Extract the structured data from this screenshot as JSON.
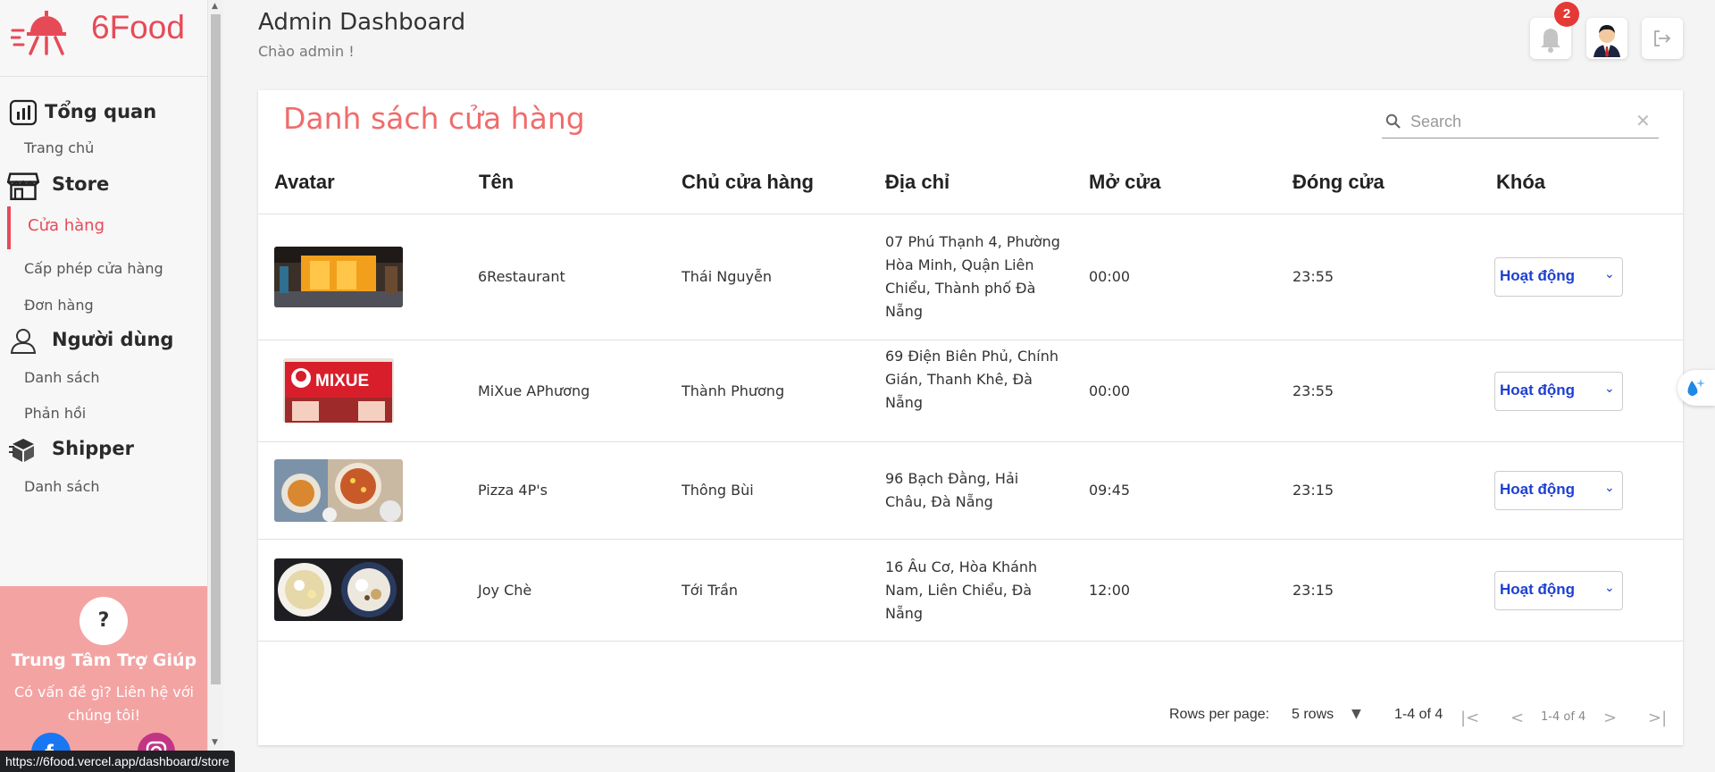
{
  "app": {
    "logo_text": "6Food",
    "status_url": "https://6food.vercel.app/dashboard/store"
  },
  "sidebar": {
    "groups": [
      {
        "title": "Tổng quan",
        "icon": "chart-icon",
        "items": [
          "Trang chủ"
        ]
      },
      {
        "title": "Store",
        "icon": "store-icon",
        "items": [
          "Cửa hàng",
          "Cấp phép cửa hàng",
          "Đơn hàng"
        ]
      },
      {
        "title": "Người dùng",
        "icon": "user-icon",
        "items": [
          "Danh sách",
          "Phản hồi"
        ]
      },
      {
        "title": "Shipper",
        "icon": "box-icon",
        "items": [
          "Danh sách"
        ]
      }
    ],
    "active_item": "Cửa hàng",
    "help": {
      "icon_text": "?",
      "title": "Trung Tâm Trợ Giúp",
      "text": "Có vấn đề gì? Liên hệ với chúng tôi!"
    }
  },
  "header": {
    "title": "Admin Dashboard",
    "subtitle": "Chào admin !",
    "notification_count": "2"
  },
  "main": {
    "title": "Danh sách cửa hàng",
    "search_placeholder": "Search",
    "columns": [
      "Avatar",
      "Tên",
      "Chủ cửa hàng",
      "Địa chỉ",
      "Mở cửa",
      "Đóng cửa",
      "Khóa"
    ],
    "rows": [
      {
        "name": "6Restaurant",
        "owner": "Thái Nguyễn",
        "address": "07 Phú Thạnh 4, Phường Hòa Minh, Quận Liên Chiểu, Thành phố Đà Nẵng",
        "open": "00:00",
        "close": "23:55",
        "status": "Hoạt động",
        "thumb": "restaurant-photo"
      },
      {
        "name": "MiXue APhương",
        "owner": "Thành Phương",
        "address": "69 Điện Biên Phủ, Chính Gián, Thanh Khê, Đà Nẵng",
        "open": "00:00",
        "close": "23:55",
        "status": "Hoạt động",
        "thumb": "mixue-storefront-photo",
        "sign_text": "MIXUE"
      },
      {
        "name": "Pizza 4P's",
        "owner": "Thông Bùi",
        "address": "96 Bạch Đằng, Hải Châu, Đà Nẵng",
        "open": "09:45",
        "close": "23:15",
        "status": "Hoạt động",
        "thumb": "pizza-photo"
      },
      {
        "name": "Joy Chè",
        "owner": "Tới Trần",
        "address": "16 Âu Cơ, Hòa Khánh Nam, Liên Chiểu, Đà Nẵng",
        "open": "12:00",
        "close": "23:15",
        "status": "Hoạt động",
        "thumb": "che-dessert-photo"
      }
    ],
    "pagination": {
      "rows_per_page_label": "Rows per page:",
      "rows_per_page_value": "5 rows",
      "range": "1-4 of 4",
      "range_small": "1-4 of 4"
    }
  },
  "colors": {
    "brand": "#e74a57",
    "title_accent": "#f06c6c",
    "status_blue": "#1d3fd1",
    "help_bg": "#f4a3a3"
  }
}
